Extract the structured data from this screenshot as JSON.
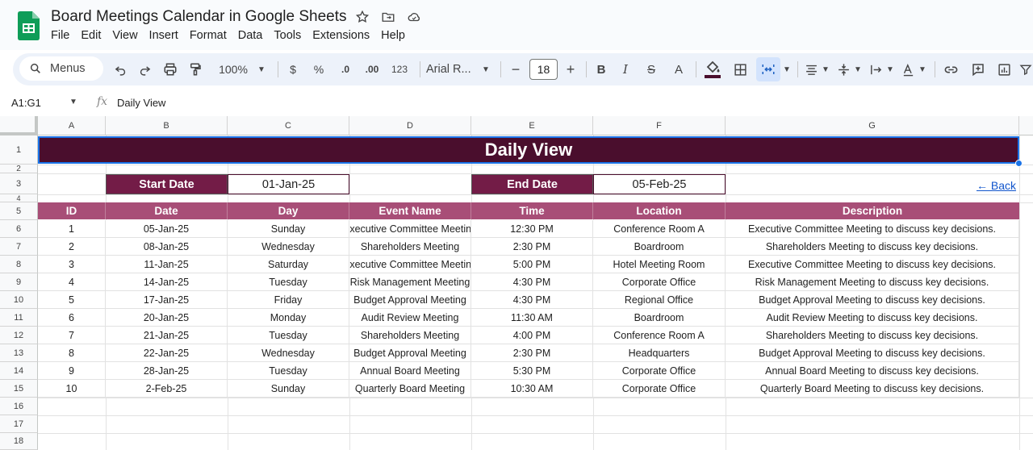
{
  "app": {
    "title": "Board Meetings Calendar in Google Sheets",
    "menu": [
      "File",
      "Edit",
      "View",
      "Insert",
      "Format",
      "Data",
      "Tools",
      "Extensions",
      "Help"
    ]
  },
  "toolbar": {
    "menus_label": "Menus",
    "zoom": "100%",
    "currency": "$",
    "percent": "%",
    "dec_decrease": ".0",
    "dec_increase": ".00",
    "number_format": "123",
    "font": "Arial R...",
    "font_size": "18",
    "minus": "−",
    "plus": "+",
    "bold": "B",
    "italic": "I",
    "strike": "S",
    "text_color": "A"
  },
  "formula_bar": {
    "name_box": "A1:G1",
    "fx": "fx",
    "value": "Daily View"
  },
  "grid": {
    "columns": [
      "A",
      "B",
      "C",
      "D",
      "E",
      "F",
      "G"
    ],
    "rows": [
      "1",
      "2",
      "3",
      "4",
      "5",
      "6",
      "7",
      "8",
      "9",
      "10",
      "11",
      "12",
      "13",
      "14",
      "15",
      "16",
      "17",
      "18"
    ]
  },
  "sheet": {
    "title": "Daily View",
    "start_date_label": "Start Date",
    "start_date_value": "01-Jan-25",
    "end_date_label": "End Date",
    "end_date_value": "05-Feb-25",
    "back_link": "← Back",
    "headers": [
      "ID",
      "Date",
      "Day",
      "Event Name",
      "Time",
      "Location",
      "Description"
    ],
    "rows": [
      [
        "1",
        "05-Jan-25",
        "Sunday",
        "Executive Committee Meeting",
        "12:30 PM",
        "Conference Room A",
        "Executive Committee Meeting to discuss key decisions."
      ],
      [
        "2",
        "08-Jan-25",
        "Wednesday",
        "Shareholders Meeting",
        "2:30 PM",
        "Boardroom",
        "Shareholders Meeting to discuss key decisions."
      ],
      [
        "3",
        "11-Jan-25",
        "Saturday",
        "Executive Committee Meeting",
        "5:00 PM",
        "Hotel Meeting Room",
        "Executive Committee Meeting to discuss key decisions."
      ],
      [
        "4",
        "14-Jan-25",
        "Tuesday",
        "Risk Management Meeting",
        "4:30 PM",
        "Corporate Office",
        "Risk Management Meeting to discuss key decisions."
      ],
      [
        "5",
        "17-Jan-25",
        "Friday",
        "Budget Approval Meeting",
        "4:30 PM",
        "Regional Office",
        "Budget Approval Meeting to discuss key decisions."
      ],
      [
        "6",
        "20-Jan-25",
        "Monday",
        "Audit Review Meeting",
        "11:30 AM",
        "Boardroom",
        "Audit Review Meeting to discuss key decisions."
      ],
      [
        "7",
        "21-Jan-25",
        "Tuesday",
        "Shareholders Meeting",
        "4:00 PM",
        "Conference Room A",
        "Shareholders Meeting to discuss key decisions."
      ],
      [
        "8",
        "22-Jan-25",
        "Wednesday",
        "Budget Approval Meeting",
        "2:30 PM",
        "Headquarters",
        "Budget Approval Meeting to discuss key decisions."
      ],
      [
        "9",
        "28-Jan-25",
        "Tuesday",
        "Annual Board Meeting",
        "5:30 PM",
        "Corporate Office",
        "Annual Board Meeting to discuss key decisions."
      ],
      [
        "10",
        "2-Feb-25",
        "Sunday",
        "Quarterly Board Meeting",
        "10:30 AM",
        "Corporate Office",
        "Quarterly Board Meeting to discuss key decisions."
      ]
    ]
  },
  "colors": {
    "title_band": "#4a0e2d",
    "date_label": "#731c47",
    "header_row": "#a84e77",
    "selection": "#1a73e8"
  }
}
